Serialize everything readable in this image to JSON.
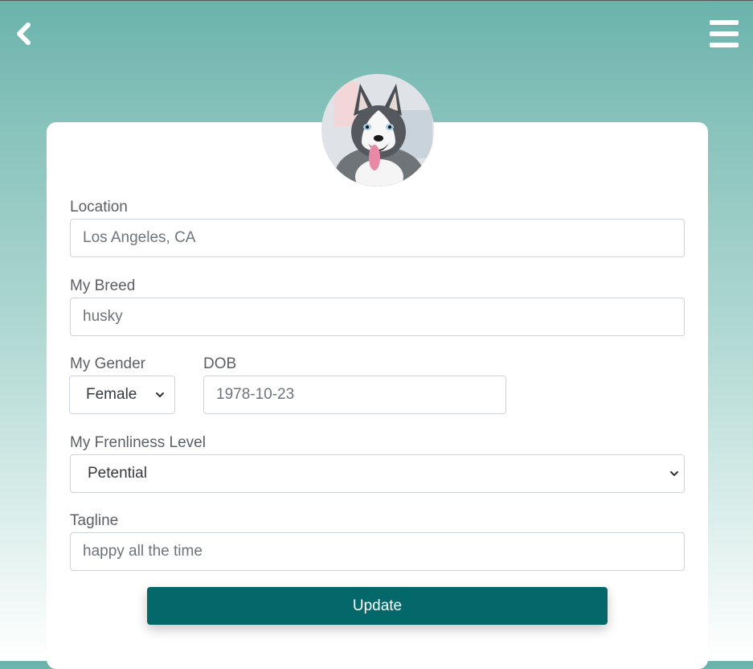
{
  "header": {
    "back_icon": "chevron-left-icon",
    "menu_icon": "hamburger-menu-icon"
  },
  "profile": {
    "avatar_alt": "husky dog photo"
  },
  "form": {
    "location": {
      "label": "Location",
      "value": "Los Angeles, CA"
    },
    "breed": {
      "label": "My Breed",
      "value": "husky"
    },
    "gender": {
      "label": "My Gender",
      "selected": "Female"
    },
    "dob": {
      "label": "DOB",
      "value": "1978-10-23"
    },
    "friendliness": {
      "label": "My Frenliness Level",
      "selected": "Petential"
    },
    "tagline": {
      "label": "Tagline",
      "value": "happy all the time"
    },
    "submit_label": "Update"
  },
  "colors": {
    "accent": "#04686b",
    "background_top": "#6ab3ac",
    "card": "#ffffff"
  }
}
